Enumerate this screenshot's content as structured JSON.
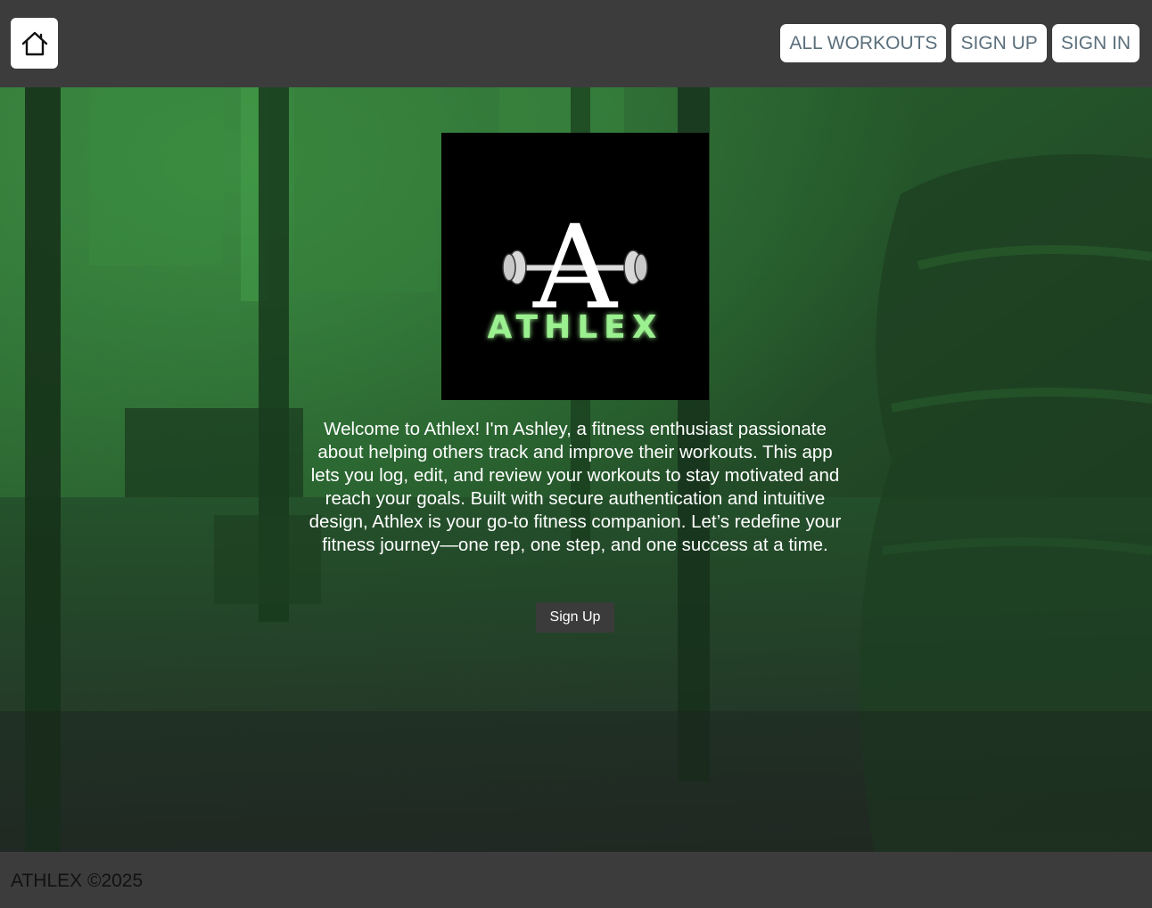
{
  "header": {
    "home_icon": "home-icon",
    "nav": [
      {
        "label": "ALL WORKOUTS"
      },
      {
        "label": "SIGN UP"
      },
      {
        "label": "SIGN IN"
      }
    ]
  },
  "hero": {
    "logo": {
      "letter": "A",
      "wordmark": "ATHLEX",
      "glow_color": "#8ef58a"
    },
    "intro": "Welcome to Athlex! I'm Ashley, a fitness enthusiast passionate about helping others track and improve their workouts. This app lets you log, edit, and review your workouts to stay motivated and reach your goals. Built with secure authentication and intuitive design, Athlex is your go-to fitness companion. Let’s redefine your fitness journey—one rep, one step, and one success at a time.",
    "cta_label": "Sign Up"
  },
  "footer": {
    "text": "ATHLEX ©2025"
  },
  "colors": {
    "header_bg": "#3d3c3d",
    "nav_text": "#5b6f7c",
    "hero_tint": "#2e6b35",
    "cta_bg": "#3b3b3b"
  }
}
